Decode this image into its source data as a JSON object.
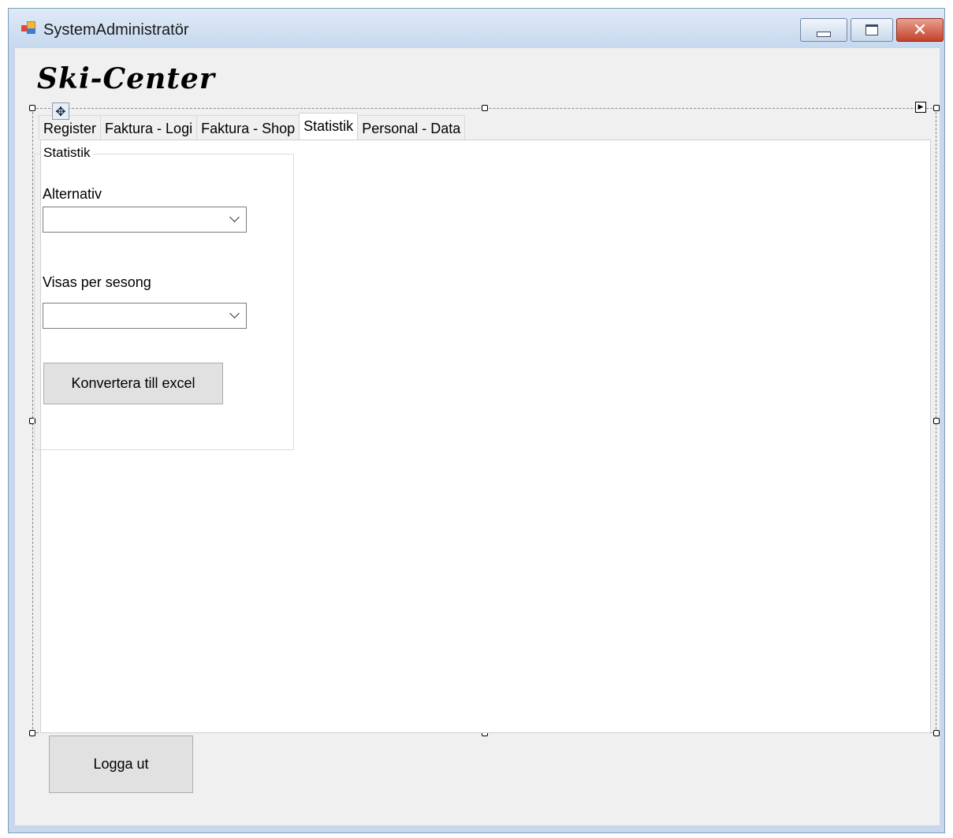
{
  "window": {
    "title": "SystemAdministratör",
    "controls": {
      "minimize_icon": "minimize-icon",
      "maximize_icon": "maximize-icon",
      "close_icon": "close-icon",
      "close_glyph": "✕"
    }
  },
  "logo": {
    "text": "Ski-Center"
  },
  "designer": {
    "move_glyph": "✥",
    "smart_tag_glyph": "▶"
  },
  "tabs": [
    {
      "label": "Register",
      "active": false
    },
    {
      "label": "Faktura - Logi",
      "active": false
    },
    {
      "label": "Faktura - Shop",
      "active": false
    },
    {
      "label": "Statistik",
      "active": true
    },
    {
      "label": "Personal - Data",
      "active": false
    }
  ],
  "statistik": {
    "group_title": "Statistik",
    "alternativ_label": "Alternativ",
    "alternativ_value": "",
    "season_label": "Visas per sesong",
    "season_value": "",
    "convert_button": "Konvertera till excel"
  },
  "logout_button": "Logga ut",
  "colors": {
    "close_button": "#c3412a",
    "panel_bg": "#f0f0f0"
  }
}
